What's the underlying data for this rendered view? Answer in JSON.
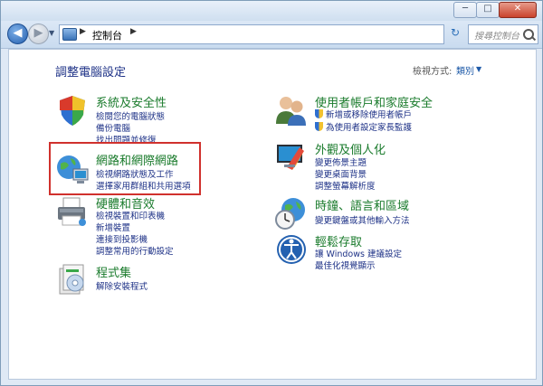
{
  "window": {
    "minimize": "─",
    "maximize": "□",
    "close": "✕"
  },
  "toolbar": {
    "back": "◀",
    "forward": "▶",
    "breadcrumb_sep": "▶",
    "address_text": "控制台",
    "refresh": "↻",
    "search_placeholder": "搜尋控制台"
  },
  "main": {
    "title": "調整電腦設定",
    "view_by_label": "檢視方式:",
    "view_by_value": "類別",
    "view_caret": "▼"
  },
  "categories": [
    {
      "title": "系統及安全性",
      "icon": "shield-icon",
      "links": [
        "檢閱您的電腦狀態",
        "備份電腦",
        "找出問題並修復"
      ]
    },
    {
      "title": "網路和網際網路",
      "icon": "network-globe-icon",
      "links": [
        "檢視網路狀態及工作",
        "選擇家用群組和共用選項"
      ]
    },
    {
      "title": "硬體和音效",
      "icon": "printer-icon",
      "links": [
        "檢視裝置和印表機",
        "新增裝置",
        "連接到投影機",
        "調整常用的行動設定"
      ]
    },
    {
      "title": "程式集",
      "icon": "programs-icon",
      "links": [
        "解除安裝程式"
      ]
    },
    {
      "title": "使用者帳戶和家庭安全",
      "icon": "users-icon",
      "links": [
        "新增或移除使用者帳戶",
        "為使用者設定家長監護"
      ]
    },
    {
      "title": "外觀及個人化",
      "icon": "display-icon",
      "links": [
        "變更佈景主題",
        "變更桌面背景",
        "調整螢幕解析度"
      ]
    },
    {
      "title": "時鐘、語言和區域",
      "icon": "clock-globe-icon",
      "links": [
        "變更鍵盤或其他輸入方法"
      ]
    },
    {
      "title": "輕鬆存取",
      "icon": "ease-of-access-icon",
      "links": [
        "讓 Windows 建議設定",
        "最佳化視覺顯示"
      ]
    }
  ],
  "colors": {
    "category_title": "#1a7b2c",
    "link": "#1e3287",
    "highlight": "#d0312d"
  }
}
